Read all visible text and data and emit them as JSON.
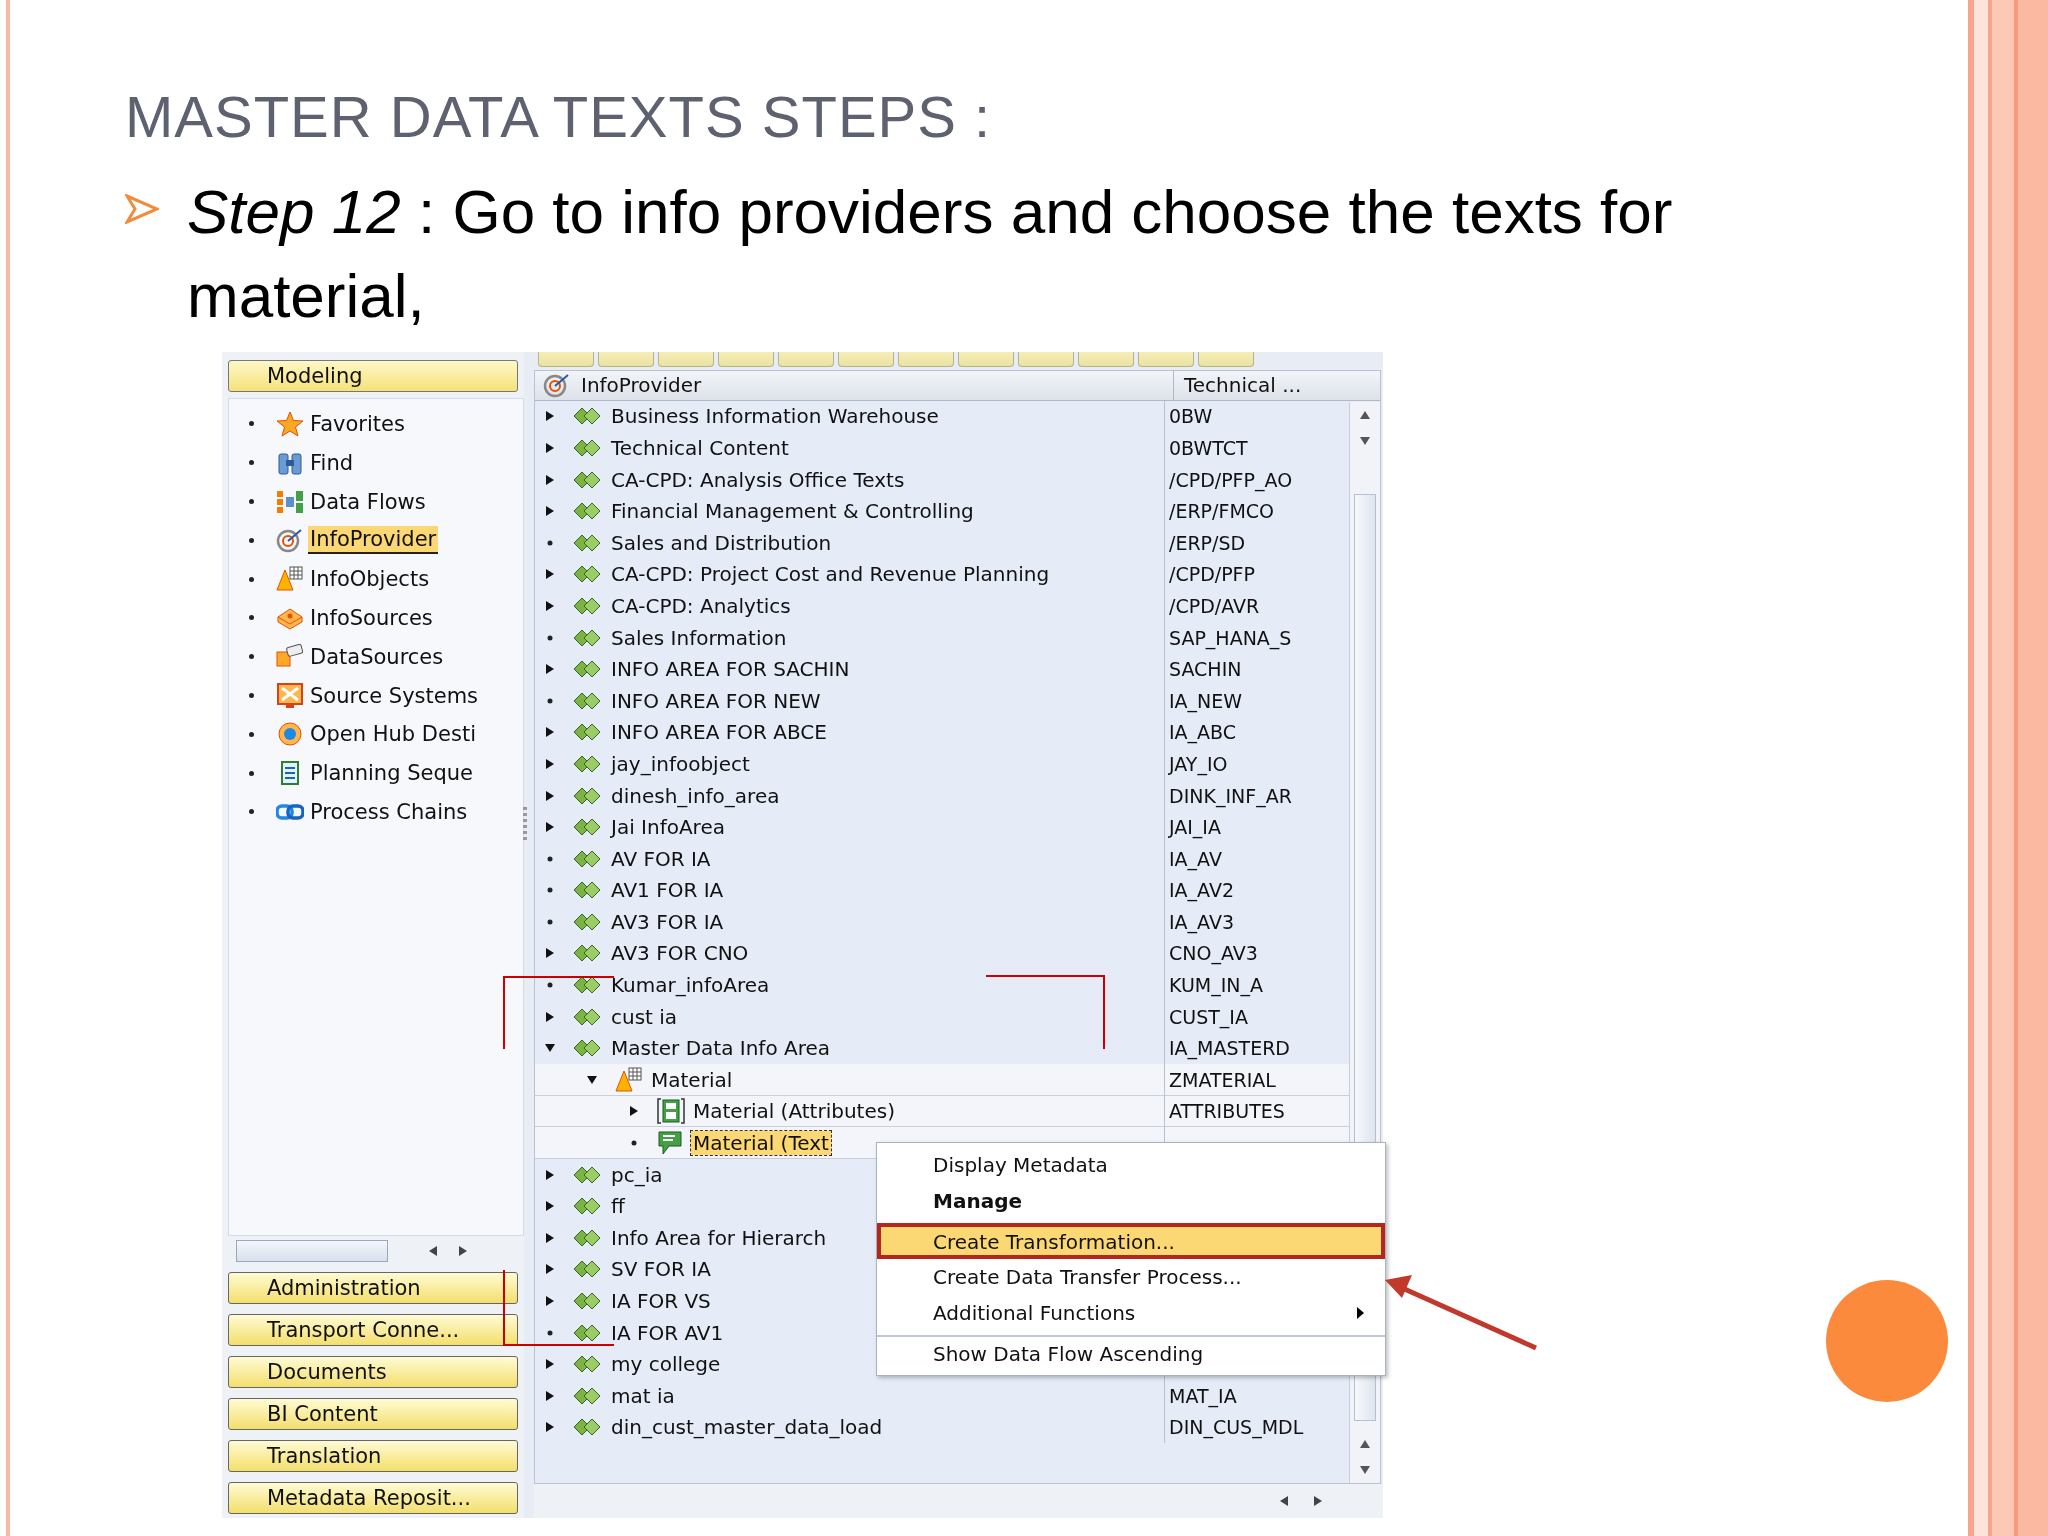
{
  "slide": {
    "title": "MASTER DATA TEXTS STEPS :",
    "bullets": [
      "*Step 12* : Go to info providers and choose the texts for material,"
    ]
  },
  "sap": {
    "sidebar": {
      "header": "Modeling",
      "items": [
        {
          "label": "Favorites",
          "selected": false
        },
        {
          "label": "Find",
          "selected": false
        },
        {
          "label": "Data Flows",
          "selected": false
        },
        {
          "label": "InfoProvider",
          "selected": true
        },
        {
          "label": "InfoObjects",
          "selected": false
        },
        {
          "label": "InfoSources",
          "selected": false
        },
        {
          "label": "DataSources",
          "selected": false
        },
        {
          "label": "Source Systems",
          "selected": false
        },
        {
          "label": "Open Hub Desti",
          "selected": false
        },
        {
          "label": "Planning Seque",
          "selected": false
        },
        {
          "label": "Process Chains",
          "selected": false
        }
      ],
      "buttons": [
        "Administration",
        "Transport Conne...",
        "Documents",
        "BI Content",
        "Translation",
        "Metadata Reposit..."
      ]
    },
    "tree": {
      "columns": [
        "InfoProvider",
        "Technical ..."
      ],
      "rows": [
        {
          "label": "Business Information Warehouse",
          "technical_name": "0BW",
          "kind": "area",
          "expandable": true,
          "expanded": false,
          "selected": false
        },
        {
          "label": "Technical Content",
          "technical_name": "0BWTCT",
          "kind": "area",
          "expandable": true,
          "expanded": false,
          "selected": false
        },
        {
          "label": "CA-CPD: Analysis Office Texts",
          "technical_name": "/CPD/PFP_AO",
          "kind": "area",
          "expandable": true,
          "expanded": false,
          "selected": false
        },
        {
          "label": "Financial Management & Controlling",
          "technical_name": "/ERP/FMCO",
          "kind": "area",
          "expandable": true,
          "expanded": false,
          "selected": false
        },
        {
          "label": "Sales and Distribution",
          "technical_name": "/ERP/SD",
          "kind": "area",
          "expandable": false,
          "expanded": false,
          "selected": false
        },
        {
          "label": "CA-CPD: Project Cost and Revenue Planning",
          "technical_name": "/CPD/PFP",
          "kind": "area",
          "expandable": true,
          "expanded": false,
          "selected": false
        },
        {
          "label": "CA-CPD: Analytics",
          "technical_name": "/CPD/AVR",
          "kind": "area",
          "expandable": true,
          "expanded": false,
          "selected": false
        },
        {
          "label": "Sales Information",
          "technical_name": "SAP_HANA_S",
          "kind": "area",
          "expandable": false,
          "expanded": false,
          "selected": false
        },
        {
          "label": "INFO AREA FOR SACHIN",
          "technical_name": "SACHIN",
          "kind": "area",
          "expandable": true,
          "expanded": false,
          "selected": false
        },
        {
          "label": "INFO AREA FOR NEW",
          "technical_name": "IA_NEW",
          "kind": "area",
          "expandable": false,
          "expanded": false,
          "selected": false
        },
        {
          "label": "INFO AREA FOR ABCE",
          "technical_name": "IA_ABC",
          "kind": "area",
          "expandable": true,
          "expanded": false,
          "selected": false
        },
        {
          "label": "jay_infoobject",
          "technical_name": "JAY_IO",
          "kind": "area",
          "expandable": true,
          "expanded": false,
          "selected": false
        },
        {
          "label": "dinesh_info_area",
          "technical_name": "DINK_INF_AR",
          "kind": "area",
          "expandable": true,
          "expanded": false,
          "selected": false
        },
        {
          "label": "Jai InfoArea",
          "technical_name": "JAI_IA",
          "kind": "area",
          "expandable": true,
          "expanded": false,
          "selected": false
        },
        {
          "label": "AV FOR IA",
          "technical_name": "IA_AV",
          "kind": "area",
          "expandable": false,
          "expanded": false,
          "selected": false
        },
        {
          "label": "AV1 FOR IA",
          "technical_name": "IA_AV2",
          "kind": "area",
          "expandable": false,
          "expanded": false,
          "selected": false
        },
        {
          "label": "AV3 FOR IA",
          "technical_name": "IA_AV3",
          "kind": "area",
          "expandable": false,
          "expanded": false,
          "selected": false
        },
        {
          "label": "AV3 FOR CNO",
          "technical_name": "CNO_AV3",
          "kind": "area",
          "expandable": true,
          "expanded": false,
          "selected": false
        },
        {
          "label": "Kumar_infoArea",
          "technical_name": "KUM_IN_A",
          "kind": "area",
          "expandable": false,
          "expanded": false,
          "selected": false
        },
        {
          "label": "cust ia",
          "technical_name": "CUST_IA",
          "kind": "area",
          "expandable": true,
          "expanded": false,
          "selected": false
        },
        {
          "label": "Master Data Info Area",
          "technical_name": "IA_MASTERD",
          "kind": "area",
          "expandable": true,
          "expanded": true,
          "selected": false,
          "children": [
            {
              "label": "Material",
              "technical_name": "ZMATERIAL",
              "kind": "infoobject",
              "expandable": true,
              "expanded": true,
              "selected": false,
              "children": [
                {
                  "label": "Material (Attributes)",
                  "technical_name": "ATTRIBUTES",
                  "kind": "attributes",
                  "expandable": true,
                  "expanded": false,
                  "selected": false
                },
                {
                  "label": "Material (Text",
                  "kind": "texts",
                  "expandable": false,
                  "expanded": false,
                  "selected": true
                }
              ]
            }
          ]
        },
        {
          "label": "pc_ia",
          "kind": "area",
          "expandable": true,
          "expanded": false,
          "selected": false
        },
        {
          "label": "ff",
          "kind": "area",
          "expandable": true,
          "expanded": false,
          "selected": false
        },
        {
          "label": "Info Area for Hierarch",
          "kind": "area",
          "expandable": true,
          "expanded": false,
          "selected": false
        },
        {
          "label": "SV FOR IA",
          "kind": "area",
          "expandable": true,
          "expanded": false,
          "selected": false
        },
        {
          "label": "IA  FOR VS",
          "kind": "area",
          "expandable": true,
          "expanded": false,
          "selected": false
        },
        {
          "label": "IA FOR AV1",
          "kind": "area",
          "expandable": false,
          "expanded": false,
          "selected": false
        },
        {
          "label": "my college",
          "kind": "area",
          "expandable": true,
          "expanded": false,
          "selected": false
        },
        {
          "label": "mat ia",
          "technical_name": "MAT_IA",
          "kind": "area",
          "expandable": true,
          "expanded": false,
          "selected": false
        },
        {
          "label": "din_cust_master_data_load",
          "technical_name": "DIN_CUS_MDL",
          "kind": "area",
          "expandable": true,
          "expanded": false,
          "selected": false
        }
      ]
    },
    "context_menu": {
      "items": [
        {
          "label": "Display Metadata",
          "default": false,
          "selected": false,
          "has_submenu": false,
          "separator_before": false
        },
        {
          "label": "Manage",
          "default": true,
          "selected": false,
          "has_submenu": false,
          "separator_before": false
        },
        {
          "label": "Create Transformation...",
          "default": false,
          "selected": true,
          "has_submenu": false,
          "separator_before": true
        },
        {
          "label": "Create Data Transfer Process...",
          "default": false,
          "selected": false,
          "has_submenu": false,
          "separator_before": false
        },
        {
          "label": "Additional Functions",
          "default": false,
          "selected": false,
          "has_submenu": true,
          "separator_before": false
        },
        {
          "label": "Show Data Flow Ascending",
          "default": false,
          "selected": false,
          "has_submenu": false,
          "separator_before": true
        }
      ]
    }
  }
}
